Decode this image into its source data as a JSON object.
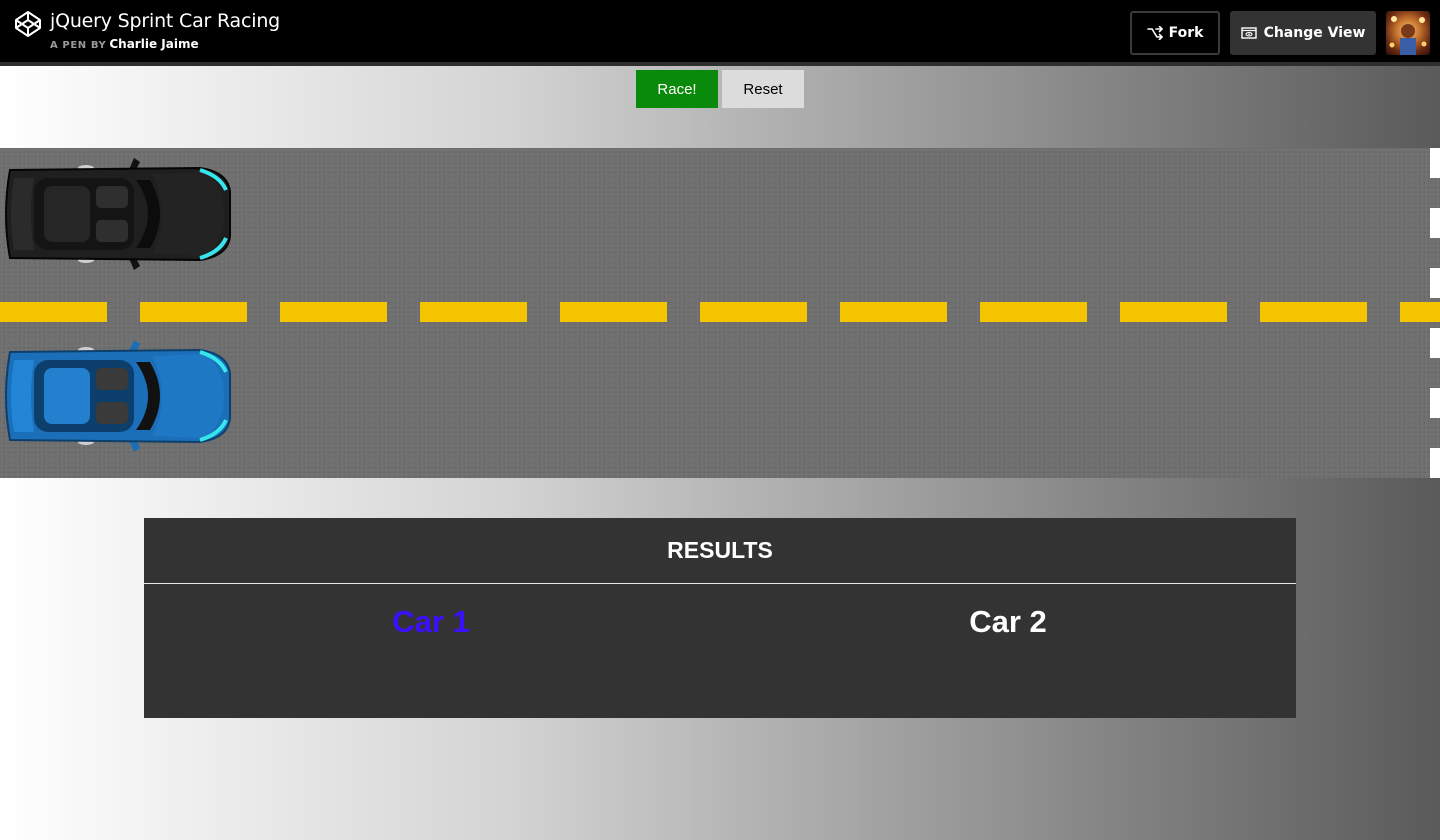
{
  "header": {
    "pen_title": "jQuery Sprint Car Racing",
    "byline_prefix": "A PEN BY",
    "author": "Charlie Jaime",
    "fork_label": "Fork",
    "change_view_label": "Change View"
  },
  "controls": {
    "race_label": "Race!",
    "reset_label": "Reset"
  },
  "results": {
    "title": "RESULTS",
    "car1_label": "Car 1",
    "car2_label": "Car 2"
  },
  "colors": {
    "race_button": "#0a8a0a",
    "lane_divider": "#f5c400",
    "car1_body": "#1f1f1f",
    "car2_body": "#1a6fb8",
    "car1_result_text": "#3a10ff",
    "car2_result_text": "#ffffff",
    "results_panel": "#333333"
  },
  "icons": [
    "codepen-logo-icon",
    "fork-icon",
    "change-view-icon"
  ]
}
